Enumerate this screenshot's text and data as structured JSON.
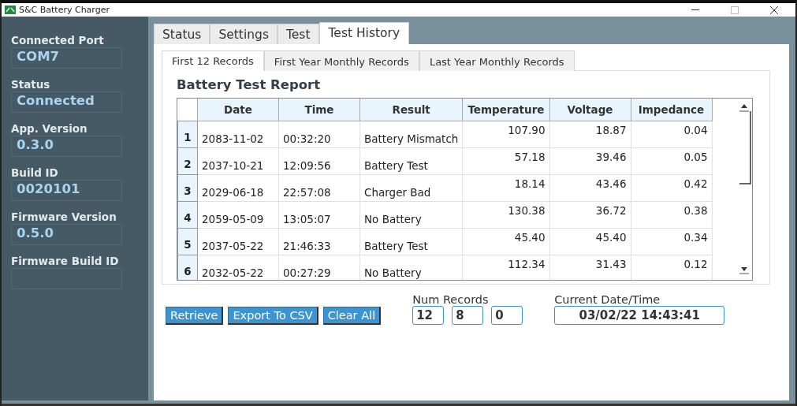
{
  "window": {
    "title": "S&C Battery Charger"
  },
  "sidebar": {
    "fields": [
      {
        "label": "Connected Port",
        "value": "COM7"
      },
      {
        "label": "Status",
        "value": "Connected"
      },
      {
        "label": "App. Version",
        "value": "0.3.0"
      },
      {
        "label": "Build ID",
        "value": "0020101"
      },
      {
        "label": "Firmware Version",
        "value": "0.5.0"
      },
      {
        "label": "Firmware Build ID"
      }
    ]
  },
  "tabs": [
    {
      "label": "Status",
      "selected": false
    },
    {
      "label": "Settings",
      "selected": false
    },
    {
      "label": "Test",
      "selected": false
    },
    {
      "label": "Test History",
      "selected": true
    }
  ],
  "subtabs": [
    {
      "label": "First 12 Records",
      "selected": true
    },
    {
      "label": "First Year Monthly Records",
      "selected": false
    },
    {
      "label": "Last Year Monthly Records",
      "selected": false
    }
  ],
  "report": {
    "title": "Battery Test Report",
    "columns": [
      "Date",
      "Time",
      "Result",
      "Temperature",
      "Voltage",
      "Impedance"
    ],
    "rows": [
      {
        "index": "1",
        "cells": [
          "2083-11-02",
          "00:32:20",
          "Battery Mismatch",
          "107.90",
          "18.87",
          "0.04"
        ]
      },
      {
        "index": "2",
        "cells": [
          "2037-10-21",
          "12:09:56",
          "Battery Test",
          "57.18",
          "39.46",
          "0.05"
        ]
      },
      {
        "index": "3",
        "cells": [
          "2029-06-18",
          "22:57:08",
          "Charger Bad",
          "18.14",
          "43.46",
          "0.42"
        ]
      },
      {
        "index": "4",
        "cells": [
          "2059-05-09",
          "13:05:07",
          "No Battery",
          "130.38",
          "36.72",
          "0.38"
        ]
      },
      {
        "index": "5",
        "cells": [
          "2037-05-22",
          "21:46:33",
          "Battery Test",
          "45.40",
          "45.40",
          "0.34"
        ]
      },
      {
        "index": "6",
        "cells": [
          "2032-05-22",
          "00:27:29",
          "No Battery",
          "112.34",
          "31.43",
          "0.12"
        ]
      }
    ]
  },
  "buttons": [
    "Retrieve",
    "Export To CSV",
    "Clear All"
  ],
  "num_records": {
    "label": "Num Records",
    "values": [
      "12",
      "8",
      "0"
    ]
  },
  "current_datetime": {
    "label": "Current Date/Time",
    "value": "03/02/22 14:43:41"
  }
}
